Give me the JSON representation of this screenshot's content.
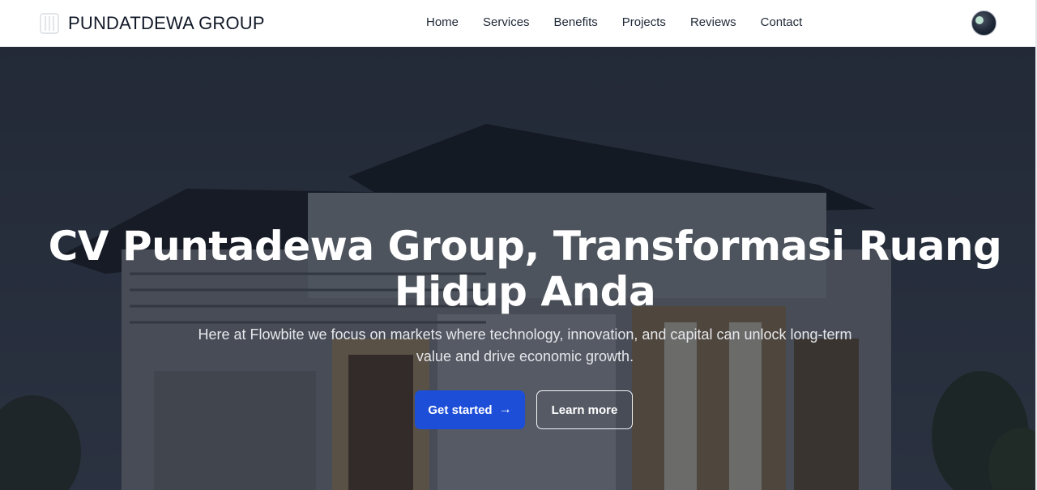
{
  "brand": {
    "name": "PUNDATDEWA GROUP",
    "logo_icon": "building-columns-icon"
  },
  "nav": {
    "items": [
      {
        "label": "Home"
      },
      {
        "label": "Services"
      },
      {
        "label": "Benefits"
      },
      {
        "label": "Projects"
      },
      {
        "label": "Reviews"
      },
      {
        "label": "Contact"
      }
    ]
  },
  "hero": {
    "title": "CV Puntadewa Group, Transformasi Ruang Hidup Anda",
    "subtitle": "Here at Flowbite we focus on markets where technology, innovation, and capital can unlock long-term value and drive economic growth.",
    "primary_button": {
      "label": "Get started",
      "icon": "arrow-right-icon"
    },
    "secondary_button": {
      "label": "Learn more"
    }
  },
  "colors": {
    "primary": "#1d4ed8",
    "nav_text": "#1f2937",
    "hero_overlay": "#111621"
  }
}
